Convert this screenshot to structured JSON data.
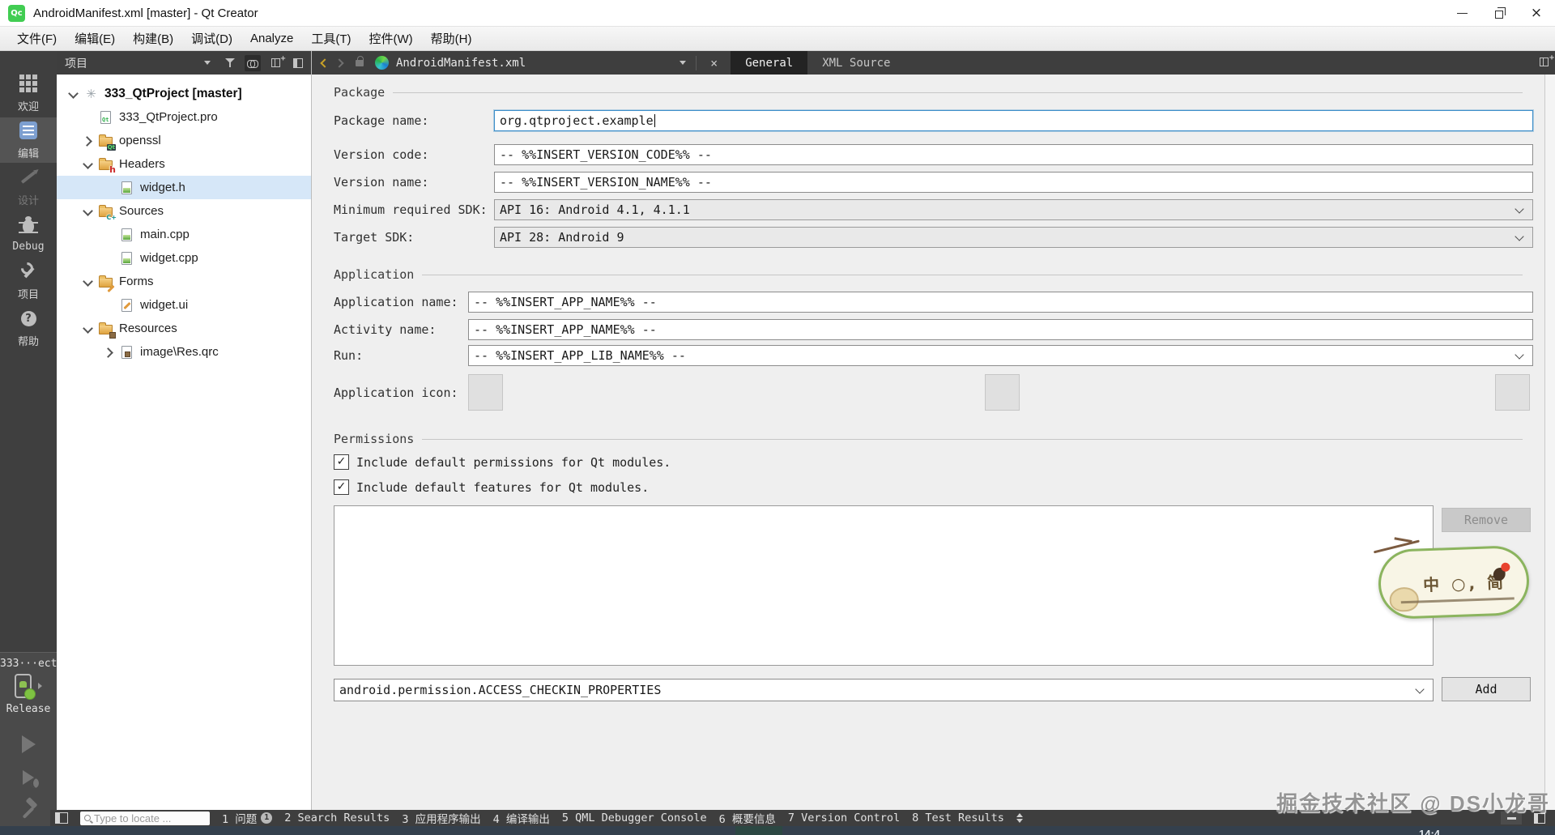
{
  "colors": {
    "accent_focus": "#3d8ec9",
    "qt_green": "#41cd52",
    "chrome_dark": "#3e3e3e",
    "tree_selection": "#d6e7f8",
    "kit_device_status": "#7ec242"
  },
  "window": {
    "title": "AndroidManifest.xml [master] - Qt Creator",
    "app_badge": "Qc"
  },
  "menu": {
    "items": [
      {
        "label": "文件(F)"
      },
      {
        "label": "编辑(E)"
      },
      {
        "label": "构建(B)"
      },
      {
        "label": "调试(D)"
      },
      {
        "label": "Analyze"
      },
      {
        "label": "工具(T)"
      },
      {
        "label": "控件(W)"
      },
      {
        "label": "帮助(H)"
      }
    ]
  },
  "mode_bar": {
    "items": [
      {
        "name": "mode-welcome",
        "label": "欢迎",
        "icon": "welcome-grid",
        "state": "normal"
      },
      {
        "name": "mode-edit",
        "label": "编辑",
        "icon": "edit-doc",
        "state": "selected"
      },
      {
        "name": "mode-design",
        "label": "设计",
        "icon": "design-pencil",
        "state": "disabled"
      },
      {
        "name": "mode-debug",
        "label": "Debug",
        "icon": "debug-bug",
        "state": "normal"
      },
      {
        "name": "mode-projects",
        "label": "项目",
        "icon": "projects-wrench",
        "state": "normal"
      },
      {
        "name": "mode-help",
        "label": "帮助",
        "icon": "help-question",
        "state": "normal"
      }
    ],
    "kit_selector": {
      "project_short": "333···ect",
      "build_config": "Release"
    },
    "run_controls": [
      {
        "name": "run-button",
        "icon": "run-triangle"
      },
      {
        "name": "debug-button",
        "icon": "debug-run"
      },
      {
        "name": "build-button",
        "icon": "build-hammer"
      }
    ]
  },
  "project_panel": {
    "title": "项目",
    "tree": [
      {
        "name": "tree-item-project-root",
        "label": "333_QtProject [master]",
        "icon": "project-root",
        "level": 0,
        "chevron": "down",
        "bold": true
      },
      {
        "name": "tree-item-pro-file",
        "label": "333_QtProject.pro",
        "icon": "file-pro",
        "level": 1
      },
      {
        "name": "tree-item-openssl",
        "label": "openssl",
        "icon": "folder-qt",
        "level": 1,
        "chevron": "right"
      },
      {
        "name": "tree-item-headers",
        "label": "Headers",
        "icon": "folder-h",
        "level": 1,
        "chevron": "down"
      },
      {
        "name": "tree-item-widget-h",
        "label": "widget.h",
        "icon": "file-modified",
        "level": 2,
        "selected": true
      },
      {
        "name": "tree-item-sources",
        "label": "Sources",
        "icon": "folder-cpp",
        "level": 1,
        "chevron": "down"
      },
      {
        "name": "tree-item-main-cpp",
        "label": "main.cpp",
        "icon": "file-modified",
        "level": 2
      },
      {
        "name": "tree-item-widget-cpp",
        "label": "widget.cpp",
        "icon": "file-modified",
        "level": 2
      },
      {
        "name": "tree-item-forms",
        "label": "Forms",
        "icon": "folder-ui",
        "level": 1,
        "chevron": "down"
      },
      {
        "name": "tree-item-widget-ui",
        "label": "widget.ui",
        "icon": "file-ui",
        "level": 2
      },
      {
        "name": "tree-item-resources",
        "label": "Resources",
        "icon": "folder-qrc",
        "level": 1,
        "chevron": "down"
      },
      {
        "name": "tree-item-res-qrc",
        "label": "image\\Res.qrc",
        "icon": "file-qrc",
        "level": 2,
        "chevron": "right"
      }
    ]
  },
  "editor_bar": {
    "document_name": "AndroidManifest.xml",
    "tabs": [
      {
        "name": "tab-general",
        "label": "General",
        "selected": true
      },
      {
        "name": "tab-xml-source",
        "label": "XML Source",
        "selected": false
      }
    ]
  },
  "form": {
    "package": {
      "title": "Package",
      "package_name_label": "Package name:",
      "package_name_value": "org.qtproject.example",
      "version_code_label": "Version code:",
      "version_code_value": "-- %%INSERT_VERSION_CODE%% --",
      "version_name_label": "Version name:",
      "version_name_value": "-- %%INSERT_VERSION_NAME%% --",
      "min_sdk_label": "Minimum required SDK:",
      "min_sdk_value": "API 16: Android 4.1, 4.1.1",
      "target_sdk_label": "Target SDK:",
      "target_sdk_value": "API 28: Android 9"
    },
    "application": {
      "title": "Application",
      "app_name_label": "Application name:",
      "app_name_value": "-- %%INSERT_APP_NAME%% --",
      "activity_name_label": "Activity name:",
      "activity_name_value": "-- %%INSERT_APP_NAME%% --",
      "run_label": "Run:",
      "run_value": "-- %%INSERT_APP_LIB_NAME%% --",
      "app_icon_label": "Application icon:"
    },
    "permissions": {
      "title": "Permissions",
      "checkbox_default_permissions": "Include default permissions for Qt modules.",
      "checkbox_default_features": "Include default features for Qt modules.",
      "checkbox_glyph": "✓",
      "remove_button": "Remove",
      "permission_combo_value": "android.permission.ACCESS_CHECKIN_PROPERTIES",
      "add_button": "Add"
    }
  },
  "status_bar": {
    "locator_placeholder": "Type to locate ...",
    "panes": [
      {
        "name": "pane-issues",
        "label": "1 问题",
        "badge": "1"
      },
      {
        "name": "pane-search-results",
        "label": "2 Search Results"
      },
      {
        "name": "pane-app-output",
        "label": "3 应用程序输出"
      },
      {
        "name": "pane-compile-output",
        "label": "4 编译输出"
      },
      {
        "name": "pane-qml-console",
        "label": "5 QML Debugger Console"
      },
      {
        "name": "pane-summary",
        "label": "6 概要信息"
      },
      {
        "name": "pane-version-control",
        "label": "7 Version Control"
      },
      {
        "name": "pane-test-results",
        "label": "8 Test Results"
      }
    ]
  },
  "watermark": {
    "community_text": "掘金技术社区 @ DS小龙哥",
    "sticker_text": "中 ○, 简"
  },
  "taskbar": {
    "clock_partial": "14:4"
  }
}
